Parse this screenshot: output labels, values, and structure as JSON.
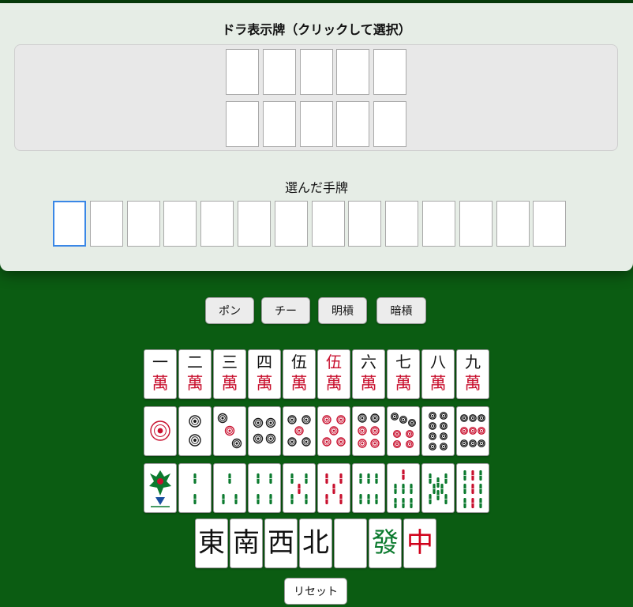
{
  "dora": {
    "title": "ドラ表示牌（クリックして選択）",
    "slots_per_row": 5,
    "rows": 2
  },
  "hand": {
    "title": "選んだ手牌",
    "slot_count": 14,
    "active_index": 0
  },
  "buttons": {
    "pon": "ポン",
    "chi": "チー",
    "minkan": "明槓",
    "ankan": "暗槓",
    "reset": "リセット"
  },
  "tiles": {
    "man": [
      {
        "num": "一",
        "suit": "萬",
        "red": false
      },
      {
        "num": "二",
        "suit": "萬",
        "red": false
      },
      {
        "num": "三",
        "suit": "萬",
        "red": false
      },
      {
        "num": "四",
        "suit": "萬",
        "red": false
      },
      {
        "num": "伍",
        "suit": "萬",
        "red": false
      },
      {
        "num": "伍",
        "suit": "萬",
        "red": true
      },
      {
        "num": "六",
        "suit": "萬",
        "red": false
      },
      {
        "num": "七",
        "suit": "萬",
        "red": false
      },
      {
        "num": "八",
        "suit": "萬",
        "red": false
      },
      {
        "num": "九",
        "suit": "萬",
        "red": false
      }
    ],
    "pin": [
      1,
      2,
      3,
      4,
      5,
      "5r",
      6,
      7,
      8,
      9
    ],
    "sou": [
      1,
      2,
      3,
      4,
      5,
      "5r",
      6,
      7,
      8,
      9
    ],
    "honors": [
      {
        "char": "東",
        "color": "black"
      },
      {
        "char": "南",
        "color": "black"
      },
      {
        "char": "西",
        "color": "black"
      },
      {
        "char": "北",
        "color": "black"
      },
      {
        "char": "",
        "color": "white"
      },
      {
        "char": "發",
        "color": "green"
      },
      {
        "char": "中",
        "color": "red"
      }
    ]
  },
  "colors": {
    "felt": "#0b5c12",
    "panel": "#e6ede6",
    "accent": "#3a87e6",
    "red": "#c8102e",
    "green": "#0b7a2e"
  }
}
